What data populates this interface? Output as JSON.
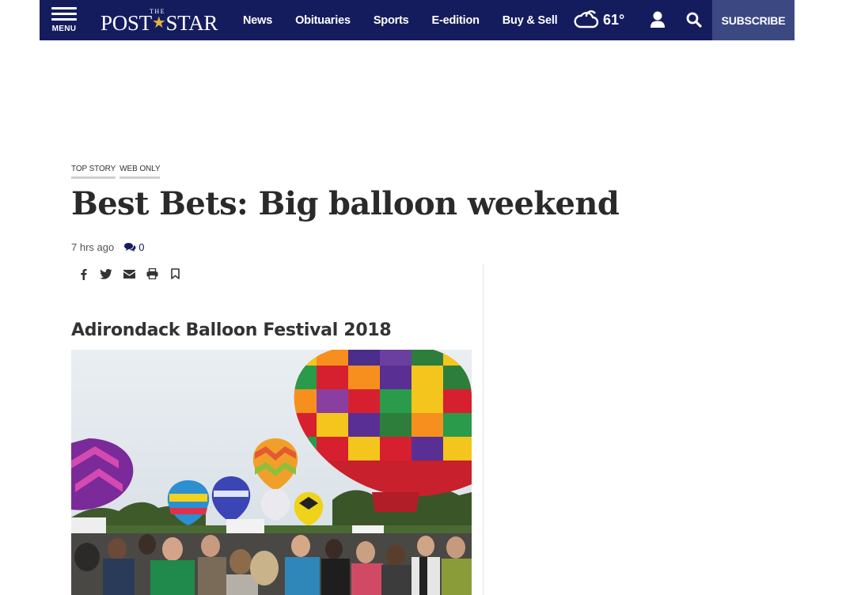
{
  "nav": {
    "menu_label": "MENU",
    "logo_the": "THE",
    "logo_post": "POST",
    "logo_star": "★",
    "logo_star_word": "STAR",
    "links": [
      "News",
      "Obituaries",
      "Sports",
      "E-edition",
      "Buy & Sell"
    ],
    "temperature": "61°",
    "weather_icon": "cloud-icon",
    "subscribe_label": "SUBSCRIBE",
    "colors": {
      "bar": "#151c5e",
      "subscribe": "#3c4882",
      "star": "#e0b243"
    }
  },
  "article": {
    "tags": [
      "TOP STORY",
      "WEB ONLY"
    ],
    "headline": "Best Bets: Big balloon weekend",
    "time_ago": "7 hrs ago",
    "comment_count": "0",
    "share_icons": [
      "facebook-icon",
      "twitter-icon",
      "email-icon",
      "print-icon",
      "bookmark-icon"
    ],
    "gallery_title": "Adirondack Balloon Festival 2018"
  }
}
